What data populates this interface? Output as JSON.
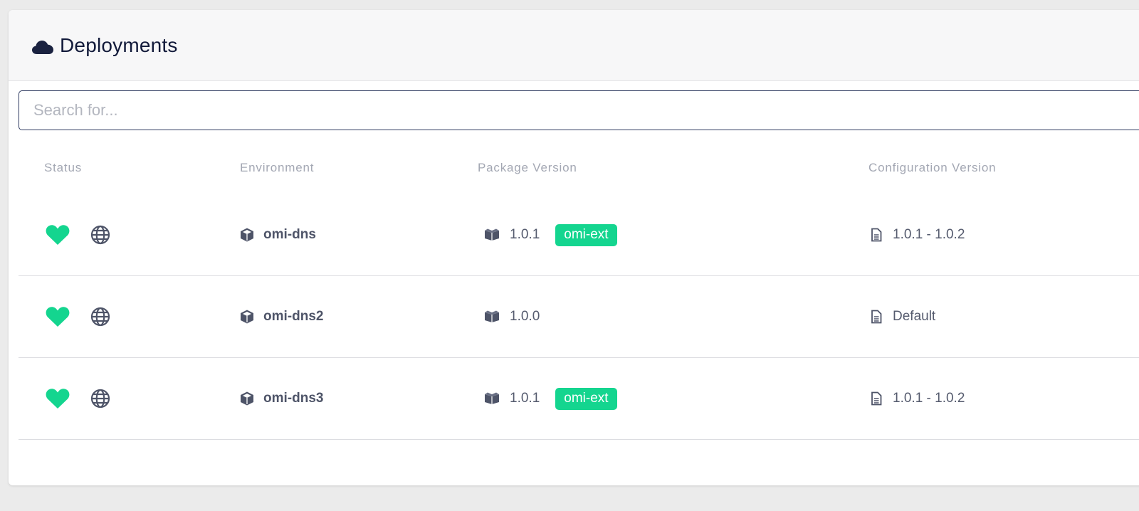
{
  "header": {
    "title": "Deployments",
    "icon": "cloud-icon"
  },
  "search": {
    "placeholder": "Search for...",
    "value": ""
  },
  "table": {
    "columns": [
      "Status",
      "Environment",
      "Package Version",
      "Configuration Version"
    ],
    "rows": [
      {
        "status": "healthy",
        "environment": "omi-dns",
        "package_version": "1.0.1",
        "package_tag": "omi-ext",
        "configuration_version": "1.0.1 - 1.0.2"
      },
      {
        "status": "healthy",
        "environment": "omi-dns2",
        "package_version": "1.0.0",
        "package_tag": "",
        "configuration_version": "Default"
      },
      {
        "status": "healthy",
        "environment": "omi-dns3",
        "package_version": "1.0.1",
        "package_tag": "omi-ext",
        "configuration_version": "1.0.1 - 1.0.2"
      }
    ]
  },
  "colors": {
    "healthy": "#14d58f",
    "badge": "#14d58f",
    "title": "#121a3a",
    "icon": "#4e5468"
  }
}
